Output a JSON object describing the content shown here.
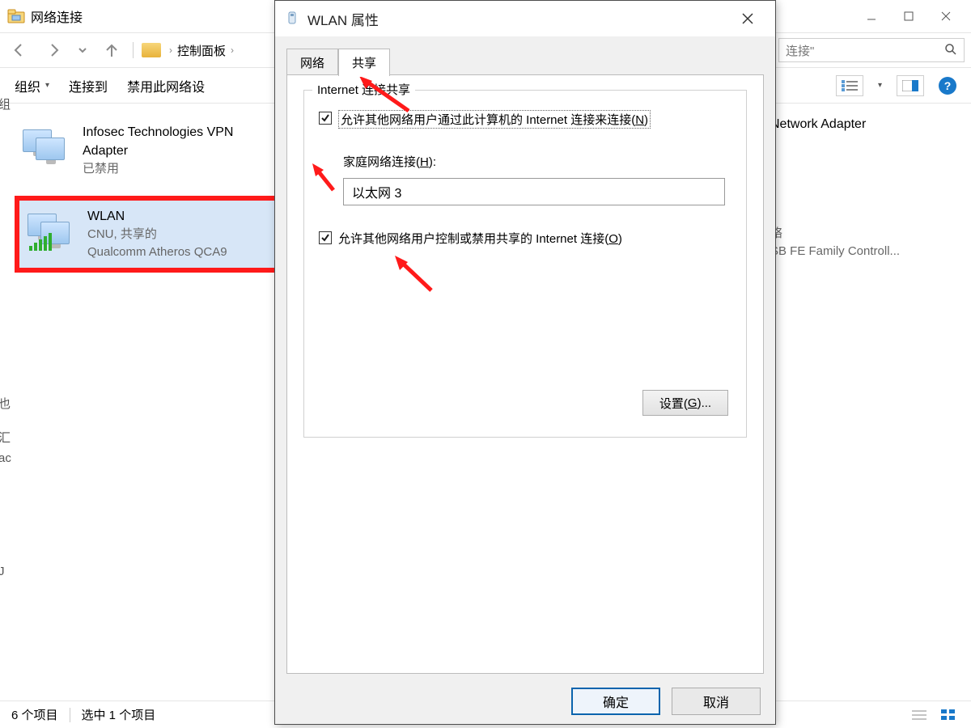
{
  "explorer": {
    "title": "网络连接",
    "breadcrumb": {
      "root": "控制面板",
      "chev": "›"
    },
    "search_placeholder_partial": "连接\"",
    "toolbar": {
      "organize": "组织",
      "connect_to": "连接到",
      "disable_partial": "禁用此网络设",
      "help": "?"
    },
    "connections": {
      "left1": {
        "name": "Infosec Technologies VPN",
        "line2": "Adapter",
        "line3": "已禁用"
      },
      "left2": {
        "name": "WLAN",
        "line2": "CNU, 共享的",
        "line3": "Qualcomm Atheros QCA9"
      },
      "right1": {
        "name_partial": "Network Adapter",
        "line2": "络",
        "line3": "SB FE Family Controll..."
      }
    },
    "statusbar": {
      "count": "6 个项目",
      "selected": "选中 1 个项目"
    },
    "edge_fragments": {
      "a": "组",
      "b": "也",
      "c": "汇",
      "d": "ac",
      "e": "J"
    }
  },
  "dialog": {
    "title": "WLAN 属性",
    "tabs": {
      "network": "网络",
      "share": "共享"
    },
    "group_legend": "Internet 连接共享",
    "chk1_before": "允许其他网络用户通过此计算机的 Internet 连接来连接(",
    "chk1_key": "N",
    "chk1_after": ")",
    "home_label_before": "家庭网络连接(",
    "home_label_key": "H",
    "home_label_after": "):",
    "home_value": "以太网 3",
    "chk2_before": "允许其他网络用户控制或禁用共享的 Internet 连接(",
    "chk2_key": "O",
    "chk2_after": ")",
    "settings_before": "设置(",
    "settings_key": "G",
    "settings_after": ")...",
    "ok": "确定",
    "cancel": "取消"
  }
}
